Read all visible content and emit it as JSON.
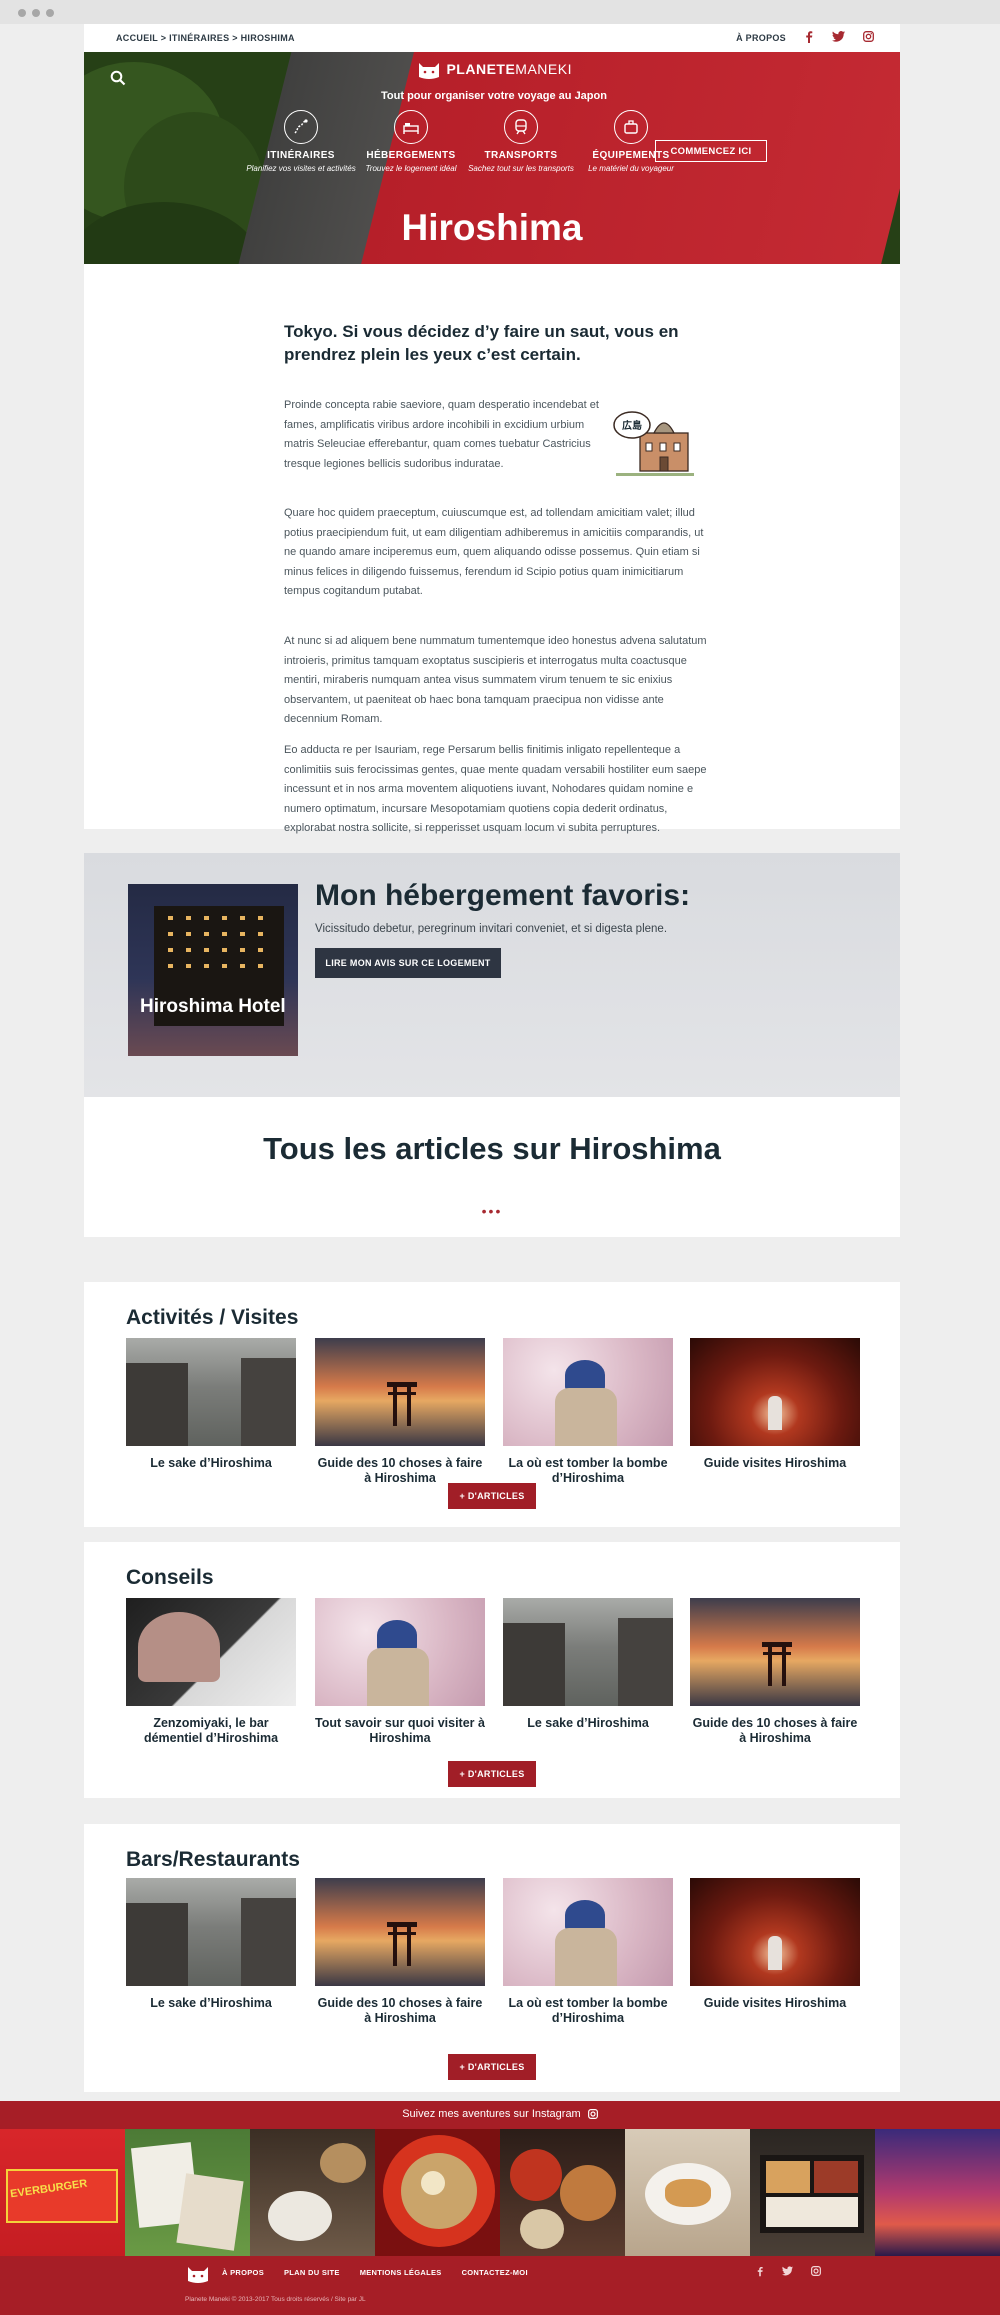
{
  "topbar": {
    "crumb_home": "ACCUEIL",
    "sep1": " > ",
    "crumb_itin": "ITINÉRAIRES",
    "sep2": " > ",
    "crumb_current": "HIROSHIMA",
    "about": "À PROPOS",
    "social": [
      "f",
      "t",
      "ig"
    ]
  },
  "hero": {
    "logo_main": "PLANETE",
    "logo_sub": "MANEKI",
    "tagline": "Tout pour organiser votre voyage au Japon",
    "nav": [
      {
        "label": "ITINÉRAIRES",
        "sub": "Planifiez vos visites et activités",
        "icon": "map-icon"
      },
      {
        "label": "HÉBERGEMENTS",
        "sub": "Trouvez le logement idéal",
        "icon": "bed-icon"
      },
      {
        "label": "TRANSPORTS",
        "sub": "Sachez tout sur les transports",
        "icon": "train-icon"
      },
      {
        "label": "ÉQUIPEMENTS",
        "sub": "Le matériel du voyageur",
        "icon": "suitcase-icon"
      }
    ],
    "cta": "COMMENCEZ ICI",
    "title": "Hiroshima"
  },
  "article": {
    "lead": "Tokyo. Si vous décidez d’y faire un saut, vous en prendrez plein les yeux c’est certain.",
    "illus_sign": "広島",
    "paragraphs": [
      "Proinde concepta rabie saeviore, quam desperatio incendebat et fames, amplificatis viribus ardore incohibili in excidium urbium matris Seleuciae efferebantur, quam comes tuebatur Castricius tresque legiones bellicis sudoribus induratae.",
      "Quare hoc quidem praeceptum, cuiuscumque est, ad tollendam amicitiam valet; illud potius praecipiendum fuit, ut eam diligentiam adhiberemus in amicitiis comparandis, ut ne quando amare inciperemus eum, quem aliquando odisse possemus. Quin etiam si minus felices in diligendo fuissemus, ferendum id Scipio potius quam inimicitiarum tempus cogitandum putabat.",
      "At nunc si ad aliquem bene nummatum tumentemque ideo honestus advena salutatum introieris, primitus tamquam exoptatus suscipieris et interrogatus multa coactusque mentiri, miraberis numquam antea visus summatem virum tenuem te sic enixius observantem, ut paeniteat ob haec bona tamquam praecipua non vidisse ante decennium Romam.",
      "Eo adducta re per Isauriam, rege Persarum bellis finitimis inligato repellenteque a conlimitiis suis ferocissimas gentes, quae mente quadam versabili hostiliter eum saepe incessunt et in nos arma moventem aliquotiens iuvant, Nohodares quidam nomine e numero optimatum, incursare Mesopotamiam quotiens copia dederit ordinatus, explorabat nostra sollicite, si repperisset usquam locum vi subita perruptures."
    ]
  },
  "hebergement": {
    "title": "Mon hébergement favoris:",
    "desc": "Vicissitudo debetur, peregrinum invitari conveniet, et si digesta plene.",
    "button": "LIRE MON AVIS SUR CE LOGEMENT",
    "photo_caption": "Hiroshima Hotel"
  },
  "articles_header": {
    "title": "Tous les articles sur Hiroshima",
    "dots": "•••"
  },
  "sections": [
    {
      "title": "Activités / Visites",
      "more": "+ D'ARTICLES",
      "items": [
        {
          "title": "Le sake d’Hiroshima",
          "img": "street"
        },
        {
          "title": "Guide des 10 choses à faire à Hiroshima",
          "img": "torii"
        },
        {
          "title": "La où est tomber la bombe d’Hiroshima",
          "img": "girl"
        },
        {
          "title": "Guide visites Hiroshima",
          "img": "gates"
        }
      ]
    },
    {
      "title": "Conseils",
      "more": "+ D'ARTICLES",
      "items": [
        {
          "title": "Zenzomiyaki, le bar démentiel d’Hiroshima",
          "img": "umbrella"
        },
        {
          "title": "Tout savoir sur quoi visiter à Hiroshima",
          "img": "girl"
        },
        {
          "title": "Le sake d’Hiroshima",
          "img": "street"
        },
        {
          "title": "Guide des 10 choses à faire à Hiroshima",
          "img": "torii"
        }
      ]
    },
    {
      "title": "Bars/Restaurants",
      "more": "+ D'ARTICLES",
      "items": [
        {
          "title": "Le sake d’Hiroshima",
          "img": "street"
        },
        {
          "title": "Guide des 10 choses à faire à Hiroshima",
          "img": "torii"
        },
        {
          "title": "La où est tomber la bombe d’Hiroshima",
          "img": "girl"
        },
        {
          "title": "Guide visites Hiroshima",
          "img": "gates"
        }
      ]
    }
  ],
  "instagram": {
    "label": "Suivez mes aventures sur Instagram",
    "tile_text": "EVERBURGER"
  },
  "footer": {
    "links": [
      "À PROPOS",
      "PLAN DU SITE",
      "MENTIONS LÉGALES",
      "CONTACTEZ-MOI"
    ],
    "copyright": "Planete Maneki © 2013-2017 Tous droits réservés / Site par JL",
    "social": [
      "f",
      "t",
      "ig"
    ]
  },
  "colors": {
    "accent": "#a61e26",
    "dark": "#1b2b34"
  }
}
